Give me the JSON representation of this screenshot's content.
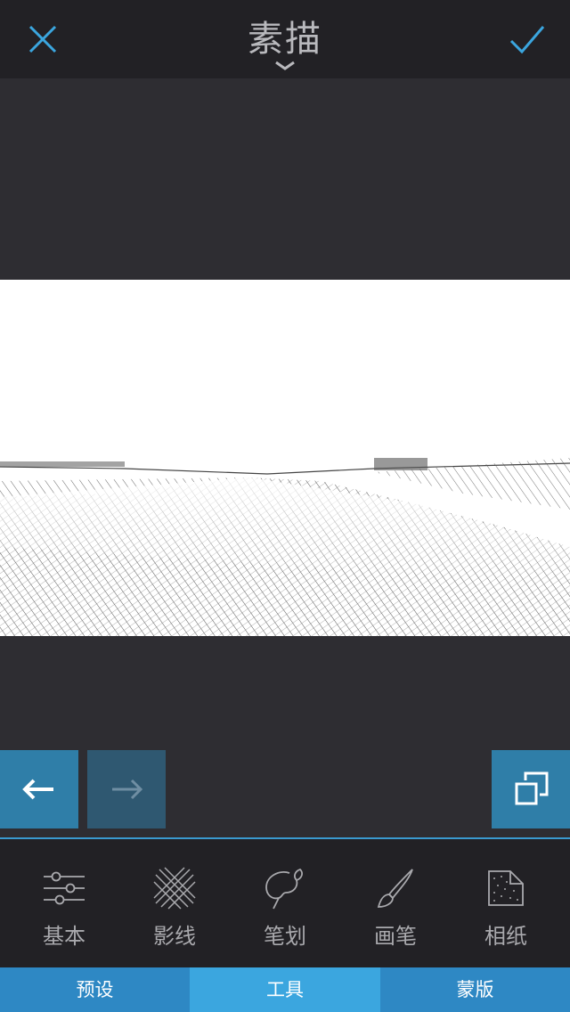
{
  "header": {
    "title": "素描",
    "close_icon": "close-icon",
    "confirm_icon": "checkmark-icon",
    "accent_color": "#3ba6df"
  },
  "canvas": {
    "image": "pencil-sketch-landscape-photo"
  },
  "history": {
    "undo_icon": "arrow-left-icon",
    "redo_icon": "arrow-right-icon",
    "redo_enabled": false,
    "compare_icon": "compare-squares-icon"
  },
  "tools": [
    {
      "label": "基本",
      "icon": "sliders-icon"
    },
    {
      "label": "影线",
      "icon": "crosshatch-icon"
    },
    {
      "label": "笔划",
      "icon": "palette-stroke-icon"
    },
    {
      "label": "画笔",
      "icon": "paintbrush-icon"
    },
    {
      "label": "相纸",
      "icon": "paper-texture-icon"
    }
  ],
  "tabs": [
    {
      "label": "预设",
      "active": false
    },
    {
      "label": "工具",
      "active": true
    },
    {
      "label": "蒙版",
      "active": false
    }
  ]
}
